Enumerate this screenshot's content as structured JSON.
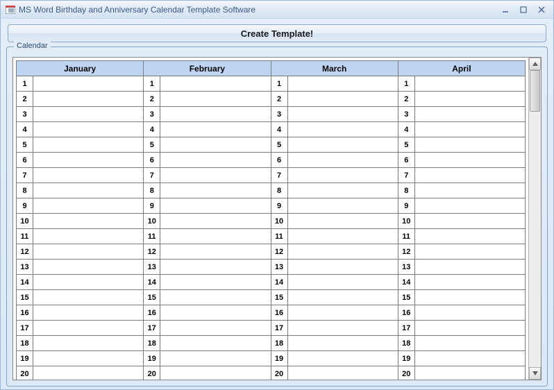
{
  "window": {
    "title": "MS Word Birthday and Anniversary Calendar Template Software"
  },
  "controls": {
    "minimize": "_",
    "maximize": "□",
    "close": "×"
  },
  "main_button": "Create Template!",
  "groupbox": {
    "legend": "Calendar"
  },
  "calendar": {
    "months": [
      "January",
      "February",
      "March",
      "April"
    ],
    "visible_days": [
      1,
      2,
      3,
      4,
      5,
      6,
      7,
      8,
      9,
      10,
      11,
      12,
      13,
      14,
      15,
      16,
      17,
      18,
      19,
      20
    ],
    "entries": {}
  }
}
